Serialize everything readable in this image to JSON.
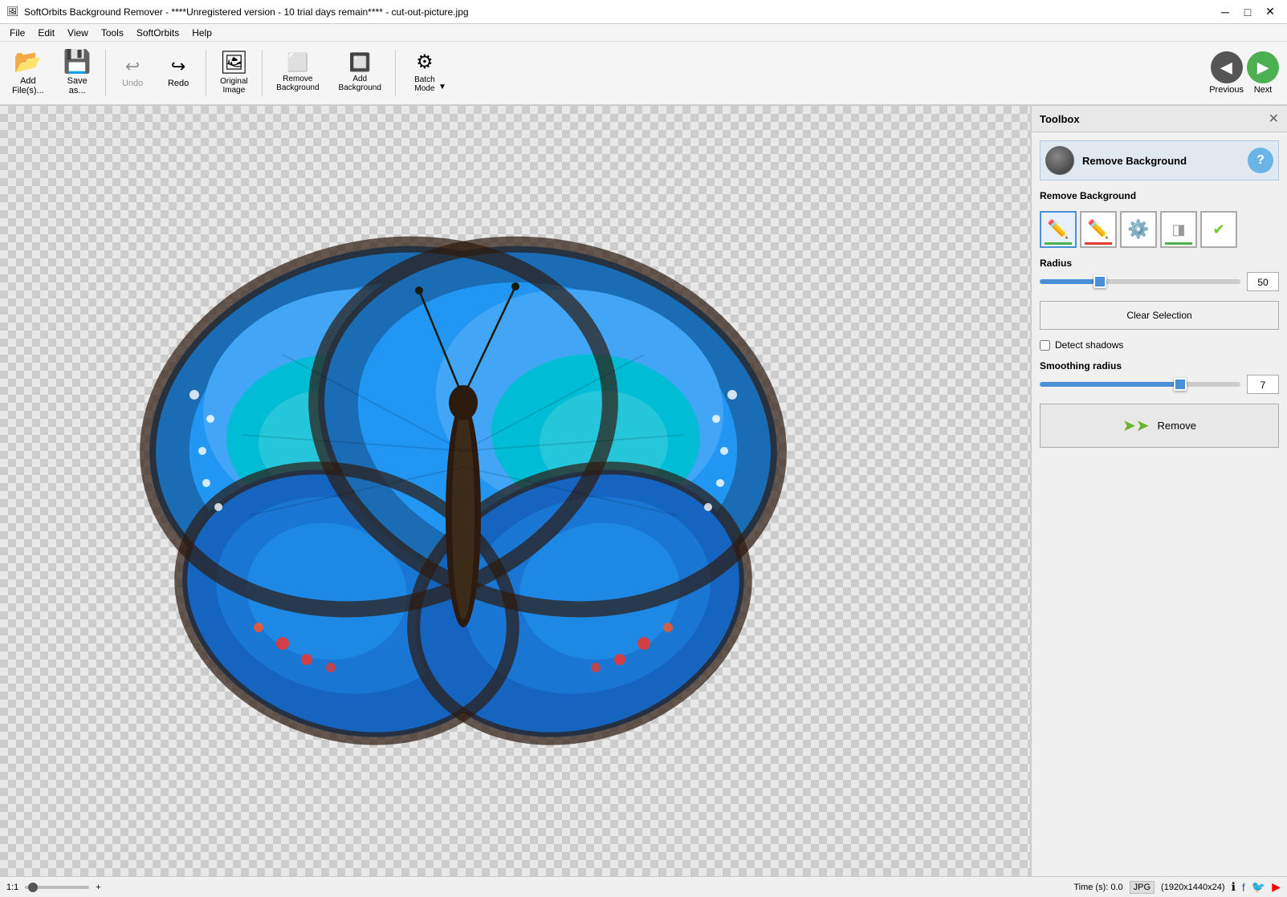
{
  "titleBar": {
    "icon": "🖼",
    "title": "SoftOrbits Background Remover - ****Unregistered version - 10 trial days remain**** - cut-out-picture.jpg",
    "minimizeBtn": "─",
    "maximizeBtn": "□",
    "closeBtn": "✕"
  },
  "menuBar": {
    "items": [
      "File",
      "Edit",
      "View",
      "Tools",
      "SoftOrbits",
      "Help"
    ]
  },
  "toolbar": {
    "buttons": [
      {
        "id": "add-files",
        "icon": "📂",
        "label": "Add\nFile(s)..."
      },
      {
        "id": "save-as",
        "icon": "💾",
        "label": "Save\nas..."
      },
      {
        "id": "undo",
        "icon": "↩",
        "label": "Undo",
        "disabled": true
      },
      {
        "id": "redo",
        "icon": "↪",
        "label": "Redo",
        "disabled": false
      },
      {
        "id": "original-image",
        "icon": "🖼",
        "label": "Original\nImage",
        "disabled": false
      },
      {
        "id": "remove-background",
        "icon": "🔲",
        "label": "Remove\nBackground"
      },
      {
        "id": "add-background",
        "icon": "🔳",
        "label": "Add\nBackground"
      },
      {
        "id": "batch-mode",
        "icon": "⚙",
        "label": "Batch\nMode",
        "hasDropdown": true
      }
    ],
    "prevBtn": {
      "label": "Previous"
    },
    "nextBtn": {
      "label": "Next"
    }
  },
  "toolbox": {
    "title": "Toolbox",
    "closeBtn": "✕",
    "sectionTitle": "Remove Background",
    "helpBtn": "?",
    "removeBackgroundLabel": "Remove Background",
    "brushTools": [
      {
        "id": "keep-brush",
        "type": "green",
        "tooltip": "Keep area brush"
      },
      {
        "id": "remove-brush",
        "type": "red",
        "tooltip": "Remove area brush"
      },
      {
        "id": "auto-remove",
        "type": "gear",
        "tooltip": "Auto remove"
      },
      {
        "id": "eraser-keep",
        "type": "eraser-keep",
        "tooltip": "Eraser keep"
      },
      {
        "id": "eraser-remove",
        "type": "eraser-remove",
        "tooltip": "Eraser remove"
      }
    ],
    "radiusLabel": "Radius",
    "radiusValue": "50",
    "radiusPercent": 30,
    "clearSelectionLabel": "Clear Selection",
    "detectShadowsLabel": "Detect shadows",
    "detectShadowsChecked": false,
    "smoothingRadiusLabel": "Smoothing radius",
    "smoothingRadiusValue": "7",
    "smoothingPercent": 70,
    "removeLabel": "Remove"
  },
  "statusBar": {
    "zoom": "1:1",
    "zoomPos": 10,
    "timeLabel": "Time (s): 0.0",
    "format": "JPG",
    "dimensions": "(1920x1440x24)"
  }
}
